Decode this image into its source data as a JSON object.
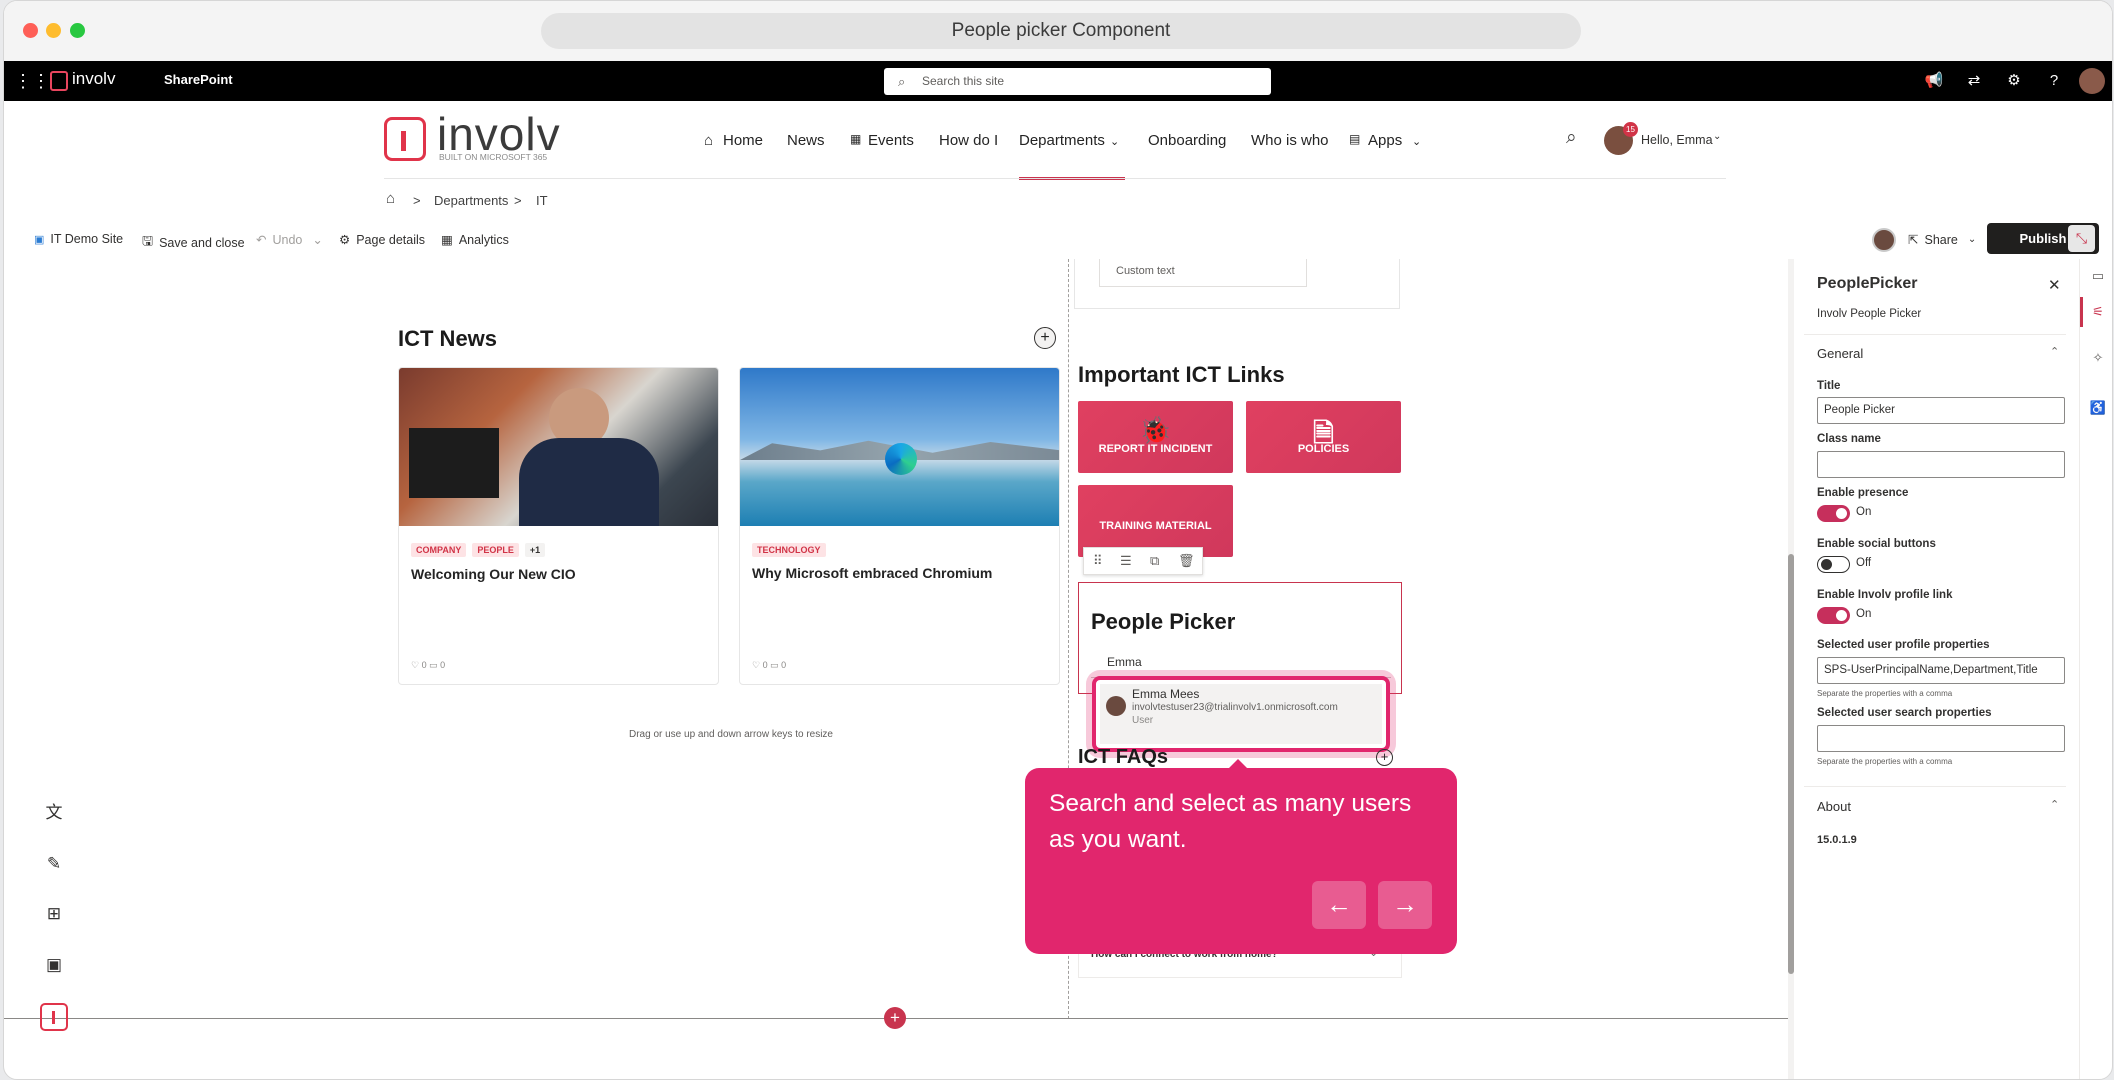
{
  "window": {
    "title": "People picker Component"
  },
  "suitebar": {
    "app_name": "SharePoint",
    "logo_text": "involv",
    "search_placeholder": "Search this site"
  },
  "site": {
    "logo_text": "involv",
    "logo_tagline": "BUILT ON MICROSOFT 365",
    "nav": [
      "Home",
      "News",
      "Events",
      "How do I",
      "Departments",
      "Onboarding",
      "Who is who",
      "Apps"
    ],
    "user": {
      "greeting": "Hello, Emma",
      "badge": "15"
    }
  },
  "breadcrumb": {
    "items": [
      "Departments",
      "IT"
    ],
    "separator": ">"
  },
  "commandbar": {
    "site_name": "IT Demo Site",
    "save_close": "Save and close",
    "undo": "Undo",
    "page_details": "Page details",
    "analytics": "Analytics",
    "share": "Share",
    "publish": "Publish"
  },
  "news": {
    "title": "ICT News",
    "cards": [
      {
        "tags": [
          "COMPANY",
          "PEOPLE",
          "+1"
        ],
        "title": "Welcoming Our New CIO",
        "likes": "0",
        "comments": "0"
      },
      {
        "tags": [
          "TECHNOLOGY"
        ],
        "title": "Why Microsoft embraced Chromium",
        "likes": "0",
        "comments": "0"
      }
    ],
    "resize_hint": "Drag or use up and down arrow keys to resize"
  },
  "custom_text": "Custom text",
  "links": {
    "title": "Important ICT Links",
    "tiles": [
      "REPORT IT INCIDENT",
      "POLICIES",
      "TRAINING MATERIAL"
    ]
  },
  "people_picker": {
    "title": "People Picker",
    "query": "Emma",
    "suggestion": {
      "name": "Emma Mees",
      "email": "involvtestuser23@trialinvolv1.onmicrosoft.com",
      "type": "User"
    }
  },
  "faqs": {
    "title": "ICT FAQs",
    "question": "How can I connect to work from home?"
  },
  "tooltip": {
    "text": "Search and select as many users as you want.",
    "prev": "←",
    "next": "→"
  },
  "pane": {
    "title": "PeoplePicker",
    "subtitle": "Involv People Picker",
    "general": "General",
    "title_label": "Title",
    "title_value": "People Picker",
    "class_label": "Class name",
    "class_value": "",
    "presence_label": "Enable presence",
    "presence_state": "On",
    "social_label": "Enable social buttons",
    "social_state": "Off",
    "profile_link_label": "Enable Involv profile link",
    "profile_link_state": "On",
    "profile_props_label": "Selected user profile properties",
    "profile_props_value": "SPS-UserPrincipalName,Department,Title",
    "profile_props_hint": "Separate the properties with a comma",
    "search_props_label": "Selected user search properties",
    "search_props_value": "",
    "search_props_hint": "Separate the properties with a comma",
    "about": "About",
    "version": "15.0.1.9"
  },
  "colors": {
    "accent": "#d13447",
    "tooltip": "#e1266d",
    "toggle_on": "#c62f5c",
    "publish": "#201f1e"
  }
}
